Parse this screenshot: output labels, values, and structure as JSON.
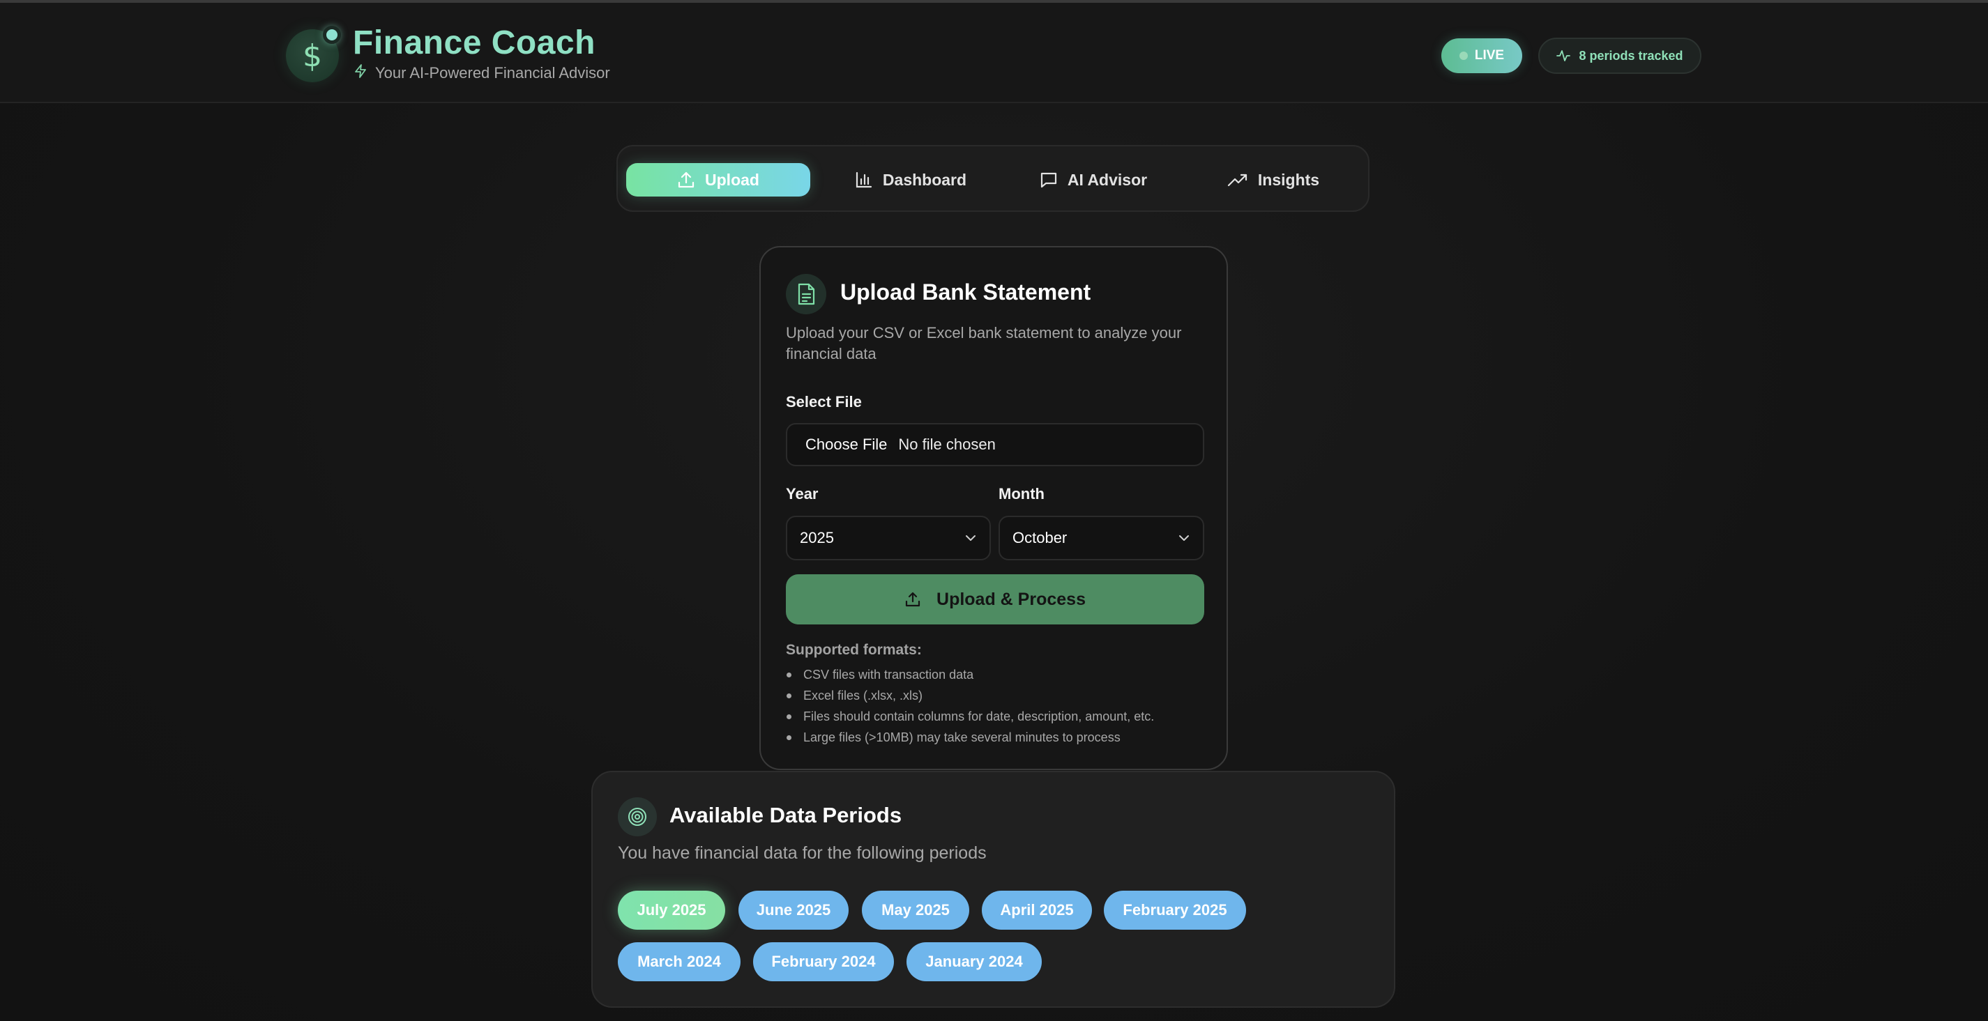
{
  "header": {
    "title": "Finance Coach",
    "subtitle": "Your AI-Powered Financial Advisor",
    "logo_icon": "dollar-icon",
    "live_label": "LIVE",
    "periods_label": "8 periods tracked"
  },
  "tabs": [
    {
      "label": "Upload",
      "icon": "upload-icon",
      "active": true
    },
    {
      "label": "Dashboard",
      "icon": "bar-chart-icon",
      "active": false
    },
    {
      "label": "AI Advisor",
      "icon": "message-icon",
      "active": false
    },
    {
      "label": "Insights",
      "icon": "trending-up-icon",
      "active": false
    }
  ],
  "upload": {
    "title": "Upload Bank Statement",
    "description": "Upload your CSV or Excel bank statement to analyze your financial data",
    "file_label": "Select File",
    "file_button": "Choose File",
    "file_status": "No file chosen",
    "year_label": "Year",
    "year_value": "2025",
    "month_label": "Month",
    "month_value": "October",
    "process_button": "Upload & Process",
    "formats_title": "Supported formats:",
    "formats": [
      "CSV files with transaction data",
      "Excel files (.xlsx, .xls)",
      "Files should contain columns for date, description, amount, etc.",
      "Large files (>10MB) may take several minutes to process"
    ]
  },
  "periods": {
    "title": "Available Data Periods",
    "description": "You have financial data for the following periods",
    "items": [
      {
        "label": "July 2025",
        "active": true
      },
      {
        "label": "June 2025",
        "active": false
      },
      {
        "label": "May 2025",
        "active": false
      },
      {
        "label": "April 2025",
        "active": false
      },
      {
        "label": "February 2025",
        "active": false
      },
      {
        "label": "March 2024",
        "active": false
      },
      {
        "label": "February 2024",
        "active": false
      },
      {
        "label": "January 2024",
        "active": false
      }
    ]
  },
  "colors": {
    "accent_green": "#78e3a2",
    "accent_cyan": "#79d6e8",
    "pill_blue": "#6fb6ec",
    "process_green": "#4e8c62",
    "title_mint": "#8fe0c4"
  }
}
